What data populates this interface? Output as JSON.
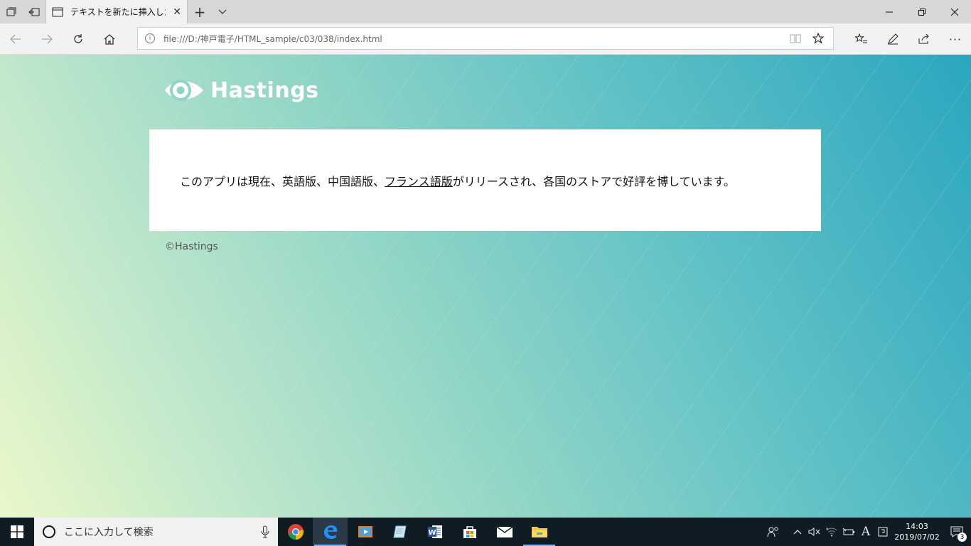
{
  "browser": {
    "tab": {
      "title": "テキストを新たに挿入したこ"
    },
    "address": {
      "url": "file:///D:/神戸電子/HTML_sample/c03/038/index.html"
    }
  },
  "page": {
    "logo_text": "Hastings",
    "text_before": "このアプリは現在、英語版、中国語版、",
    "link_text": "フランス語版",
    "text_after": "がリリースされ、各国のストアで好評を博しています。",
    "copyright": "©Hastings"
  },
  "taskbar": {
    "search_placeholder": "ここに入力して検索",
    "time": "14:03",
    "date": "2019/07/02",
    "notification_count": "3",
    "ime_label": "A"
  }
}
